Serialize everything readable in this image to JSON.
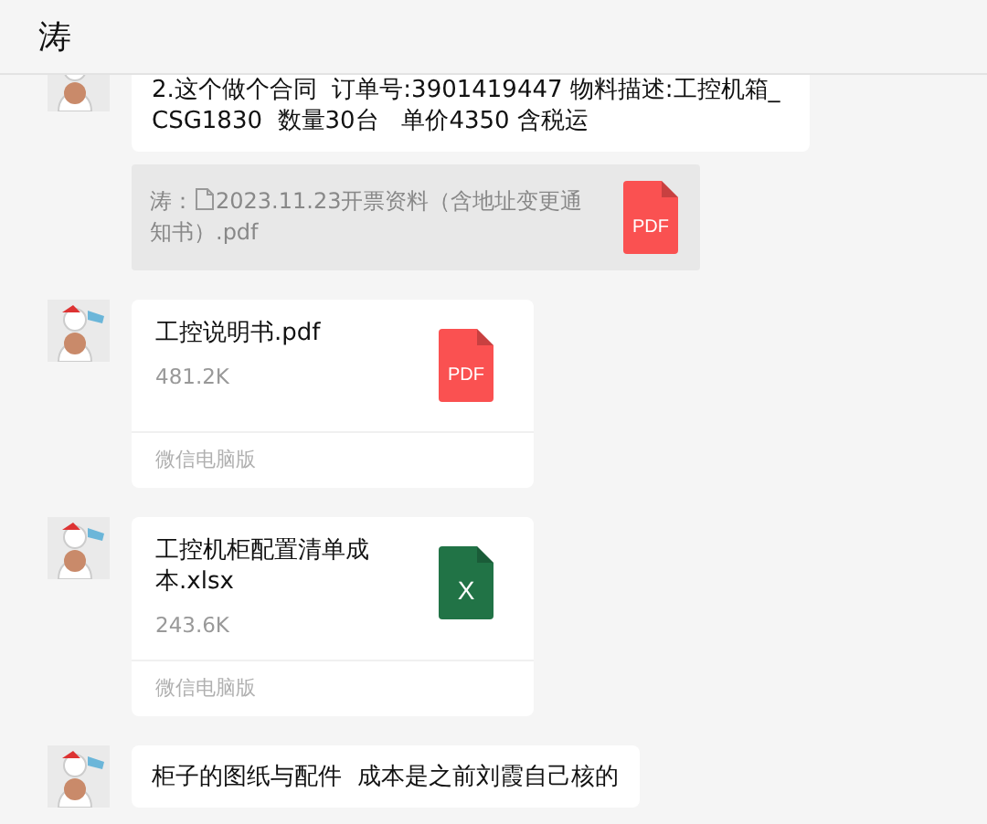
{
  "header": {
    "title": "涛"
  },
  "messages": [
    {
      "kind": "text",
      "text": "2.这个做个合同  订单号:3901419447 物料描述:工控机箱_CSG1830  数量30台   单价4350 含税运",
      "quote": {
        "sender": "涛：",
        "file_name": "2023.11.23开票资料（含地址变更通知书）.pdf",
        "icon": {
          "kind": "pdf",
          "label": "PDF"
        }
      }
    },
    {
      "kind": "file",
      "file_name": "工控说明书.pdf",
      "size": "481.2K",
      "source": "微信电脑版",
      "icon": {
        "kind": "pdf",
        "label": "PDF"
      }
    },
    {
      "kind": "file",
      "file_name": "工控机柜配置清单成本.xlsx",
      "size": "243.6K",
      "source": "微信电脑版",
      "icon": {
        "kind": "sheet",
        "label": "X"
      }
    },
    {
      "kind": "text",
      "text": "柜子的图纸与配件  成本是之前刘霞自己核的"
    }
  ]
}
